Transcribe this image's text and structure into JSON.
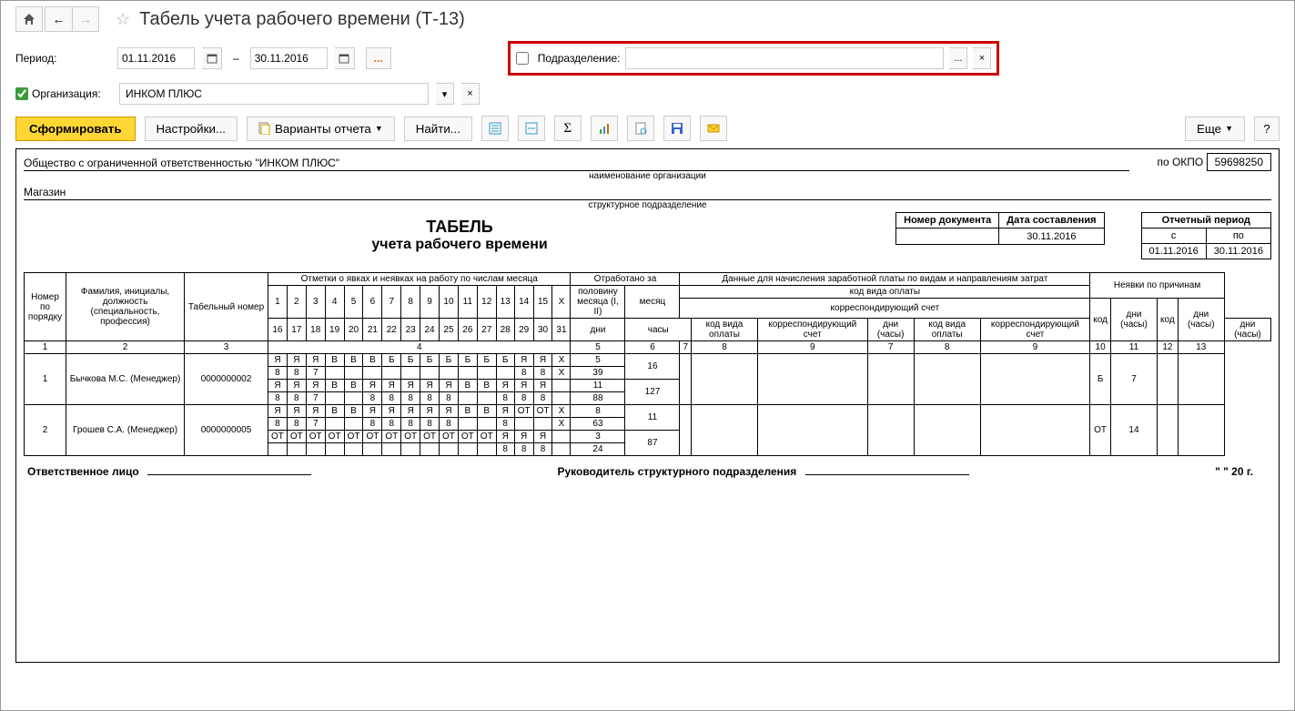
{
  "title": "Табель учета рабочего времени (Т-13)",
  "filters": {
    "period_label": "Период:",
    "date_from": "01.11.2016",
    "dash": "–",
    "date_to": "30.11.2016",
    "ellipsis": "...",
    "org_label": "Организация:",
    "org_value": "ИНКОМ ПЛЮС",
    "dept_label": "Подразделение:",
    "dept_value": ""
  },
  "toolbar": {
    "form": "Сформировать",
    "settings": "Настройки...",
    "variants": "Варианты отчета",
    "find": "Найти...",
    "more": "Еще",
    "help": "?"
  },
  "report": {
    "org_full": "Общество с ограниченной ответственностью \"ИНКОМ ПЛЮС\"",
    "org_caption": "наименование организации",
    "dept_full": "Магазин",
    "dept_caption": "структурное подразделение",
    "okpo_label": "по ОКПО",
    "okpo_value": "59698250",
    "title": "ТАБЕЛЬ",
    "subtitle": "учета  рабочего времени",
    "doc_num_label": "Номер документа",
    "doc_date_label": "Дата составления",
    "doc_num": "",
    "doc_date": "30.11.2016",
    "period_label": "Отчетный период",
    "period_from_label": "с",
    "period_to_label": "по",
    "period_from": "01.11.2016",
    "period_to": "30.11.2016"
  },
  "headers": {
    "num": "Номер по порядку",
    "fio": "Фамилия, инициалы, должность (специальность, профессия)",
    "tabnum": "Табельный номер",
    "marks": "Отметки о явках и неявках на работу по числам месяца",
    "worked": "Отработано за",
    "half": "половину месяца (I, II)",
    "month": "месяц",
    "days": "дни",
    "hours": "часы",
    "pay_data": "Данные для начисления заработной платы по видам и направлениям затрат",
    "pay_code_type": "код вида оплаты",
    "corr_acc": "корреспондирующий счет",
    "code_pay": "код вида оплаты",
    "corr": "корреспондирующий счет",
    "dh": "дни (часы)",
    "absence": "Неявки по причинам",
    "code": "код",
    "d1_15": [
      "1",
      "2",
      "3",
      "4",
      "5",
      "6",
      "7",
      "8",
      "9",
      "10",
      "11",
      "12",
      "13",
      "14",
      "15",
      "X"
    ],
    "d16_31": [
      "16",
      "17",
      "18",
      "19",
      "20",
      "21",
      "22",
      "23",
      "24",
      "25",
      "26",
      "27",
      "28",
      "29",
      "30",
      "31"
    ],
    "colnums": [
      "1",
      "2",
      "3",
      "4",
      "5",
      "6",
      "7",
      "8",
      "9",
      "10",
      "11",
      "12",
      "13"
    ]
  },
  "rows": [
    {
      "num": "1",
      "fio": "Бычкова М.С. (Менеджер)",
      "tabnum": "0000000002",
      "r1": [
        "Я",
        "Я",
        "Я",
        "В",
        "В",
        "В",
        "Б",
        "Б",
        "Б",
        "Б",
        "Б",
        "Б",
        "Б",
        "Я",
        "Я",
        "Х"
      ],
      "r2": [
        "8",
        "8",
        "7",
        "",
        "",
        "",
        "",
        "",
        "",
        "",
        "",
        "",
        "",
        "8",
        "8",
        "Х"
      ],
      "r3": [
        "Я",
        "Я",
        "Я",
        "В",
        "В",
        "Я",
        "Я",
        "Я",
        "Я",
        "Я",
        "В",
        "В",
        "Я",
        "Я",
        "Я",
        ""
      ],
      "r4": [
        "8",
        "8",
        "7",
        "",
        "",
        "8",
        "8",
        "8",
        "8",
        "8",
        "",
        "",
        "8",
        "8",
        "8",
        ""
      ],
      "half_days": [
        "5",
        "11"
      ],
      "half_hours": [
        "39",
        "88"
      ],
      "month_days": "16",
      "month_hours": "127",
      "abs_code": "Б",
      "abs_days": "7"
    },
    {
      "num": "2",
      "fio": "Грошев  С.А. (Менеджер)",
      "tabnum": "0000000005",
      "r1": [
        "Я",
        "Я",
        "Я",
        "В",
        "В",
        "Я",
        "Я",
        "Я",
        "Я",
        "Я",
        "В",
        "В",
        "Я",
        "ОТ",
        "ОТ",
        "Х"
      ],
      "r2": [
        "8",
        "8",
        "7",
        "",
        "",
        "8",
        "8",
        "8",
        "8",
        "8",
        "",
        "",
        "8",
        "",
        "",
        "Х"
      ],
      "r3": [
        "ОТ",
        "ОТ",
        "ОТ",
        "ОТ",
        "ОТ",
        "ОТ",
        "ОТ",
        "ОТ",
        "ОТ",
        "ОТ",
        "ОТ",
        "ОТ",
        "Я",
        "Я",
        "Я",
        ""
      ],
      "r4": [
        "",
        "",
        "",
        "",
        "",
        "",
        "",
        "",
        "",
        "",
        "",
        "",
        "8",
        "8",
        "8",
        ""
      ],
      "half_days": [
        "8",
        "3"
      ],
      "half_hours": [
        "63",
        "24"
      ],
      "month_days": "11",
      "month_hours": "87",
      "abs_code": "ОТ",
      "abs_days": "14"
    }
  ],
  "footer": {
    "resp": "Ответственное лицо",
    "head": "Руководитель структурного подразделения",
    "date_pat": "\"   \"              20    г."
  }
}
